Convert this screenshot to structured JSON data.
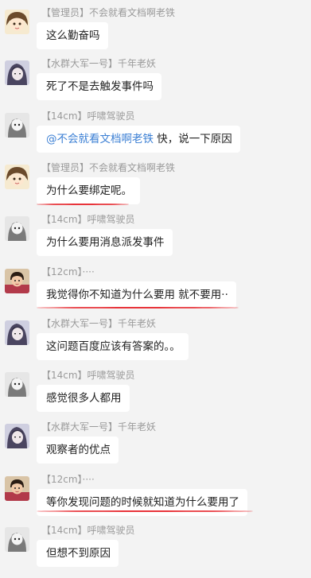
{
  "messages": [
    {
      "sender": "【管理员】不会就看文档啊老铁",
      "text": "这么勤奋吗",
      "avatar": "girl-brown-hair"
    },
    {
      "sender": "【水群大军一号】千年老妖",
      "text": "死了不是去触发事件吗",
      "avatar": "dark-hair-character"
    },
    {
      "sender": "【14cm】呼啸驾驶员",
      "mention": "@不会就看文档啊老铁",
      "text": " 快，说一下原因",
      "avatar": "gray-character"
    },
    {
      "sender": "【管理员】不会就看文档啊老铁",
      "text": "为什么要绑定呢。",
      "avatar": "girl-brown-hair"
    },
    {
      "sender": "【14cm】呼啸驾驶员",
      "text": "为什么要用消息派发事件",
      "avatar": "gray-character"
    },
    {
      "sender": "【12cm】····",
      "text": "我觉得你不知道为什么要用 就不要用··",
      "avatar": "child-photo"
    },
    {
      "sender": "【水群大军一号】千年老妖",
      "text": "这问题百度应该有答案的。。",
      "avatar": "dark-hair-character"
    },
    {
      "sender": "【14cm】呼啸驾驶员",
      "text": "感觉很多人都用",
      "avatar": "gray-character"
    },
    {
      "sender": "【水群大军一号】千年老妖",
      "text": "观察者的优点",
      "avatar": "dark-hair-character"
    },
    {
      "sender": "【12cm】····",
      "text": "等你发现问题的时候就知道为什么要用了",
      "avatar": "child-photo"
    },
    {
      "sender": "【14cm】呼啸驾驶员",
      "text": "但想不到原因",
      "avatar": "gray-character"
    }
  ],
  "colors": {
    "underline": "#e8343a",
    "mention": "#3b7fd4",
    "background": "#f3f3f3"
  }
}
